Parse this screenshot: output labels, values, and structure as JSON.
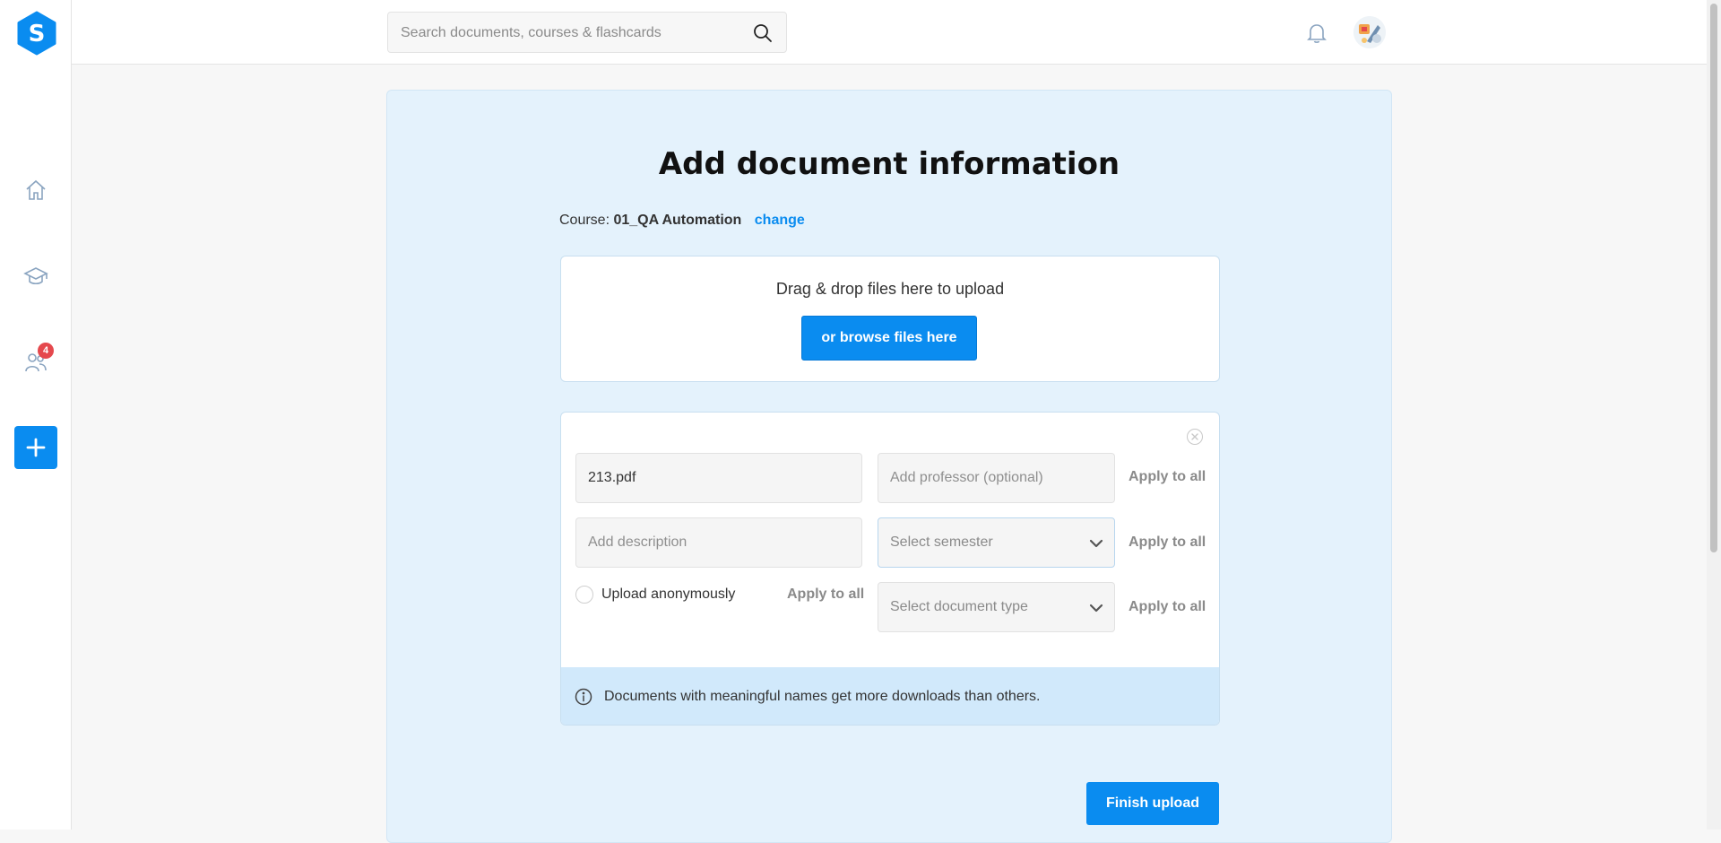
{
  "sidebar": {
    "logo_letter": "S",
    "items": [
      {
        "icon": "home-icon"
      },
      {
        "icon": "graduation-cap-icon"
      },
      {
        "icon": "study-group-icon",
        "badge": "4"
      }
    ],
    "add_icon": "plus-icon"
  },
  "topbar": {
    "search_placeholder": "Search documents, courses & flashcards",
    "search_icon": "search-icon",
    "bell_icon": "bell-icon"
  },
  "main": {
    "title": "Add document information",
    "course_prefix": "Course:",
    "course_name": "01_QA Automation",
    "change_label": "change",
    "dropzone_text": "Drag & drop files here to upload",
    "browse_label": "or browse files here",
    "form": {
      "filename": "213.pdf",
      "professor_placeholder": "Add professor (optional)",
      "description_placeholder": "Add description",
      "semester_placeholder": "Select semester",
      "document_type_placeholder": "Select document type",
      "anonymous_label": "Upload anonymously",
      "apply_to_all": "Apply to all"
    },
    "info_text": "Documents with meaningful names get more downloads than others.",
    "finish_label": "Finish upload"
  },
  "colors": {
    "accent": "#0a8cf0",
    "panel_bg": "#e4f2fc",
    "badge": "#e5484d"
  }
}
